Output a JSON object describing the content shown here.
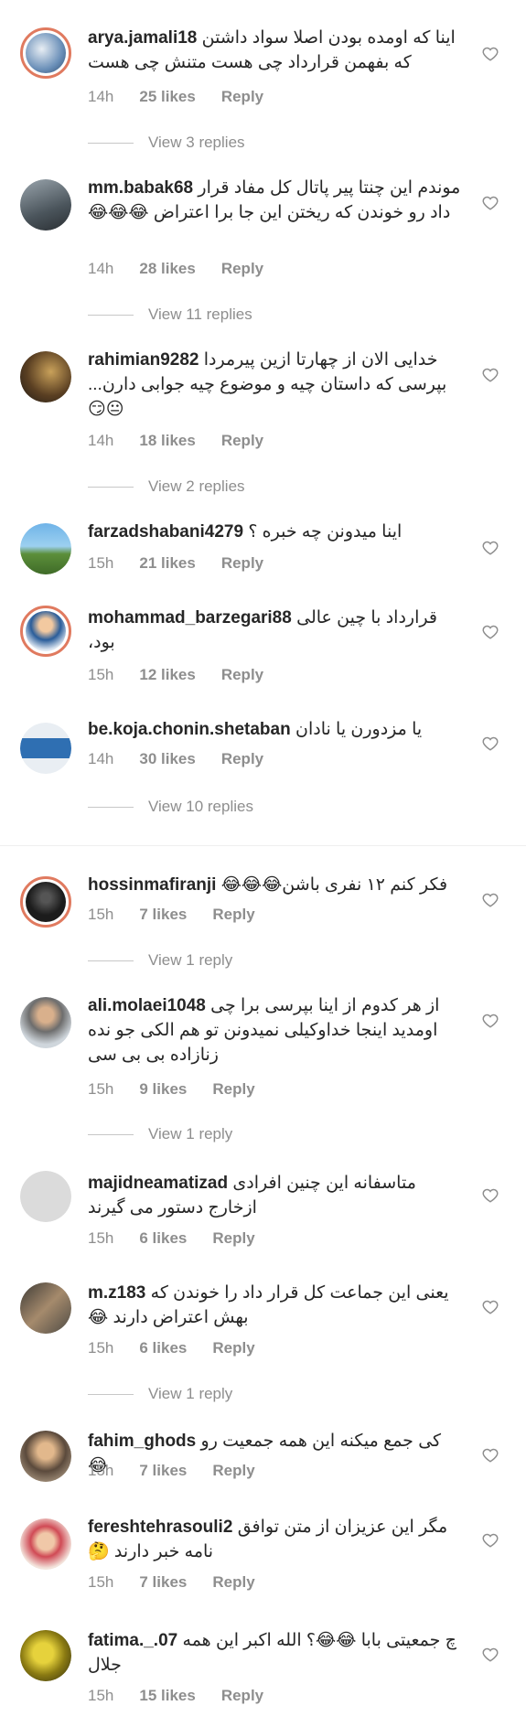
{
  "comments": [
    {
      "username": "arya.jamali18",
      "text": "اینا که اومده بودن اصلا سواد داشتن که بفهمن قرارداد چی هست متنش چی هست",
      "time": "14h",
      "likes": "25 likes",
      "reply": "Reply",
      "view_replies": "View 3 replies"
    },
    {
      "username": "mm.babak68",
      "text": "موندم این چنتا پیر پاتال  کل مفاد قرار داد رو خوندن که ریختن این جا برا اعتراض 😂😂😂",
      "time": "14h",
      "likes": "28 likes",
      "reply": "Reply",
      "view_replies": "View 11 replies"
    },
    {
      "username": "rahimian9282",
      "text": "خدایی الان از چهارتا ازین پیرمردا بپرسی که داستان چیه و موضوع چیه جوابی دارن... 😐😏",
      "time": "14h",
      "likes": "18 likes",
      "reply": "Reply",
      "view_replies": "View 2 replies"
    },
    {
      "username": "farzadshabani4279",
      "text": "اینا میدونن چه خبره ؟",
      "time": "15h",
      "likes": "21 likes",
      "reply": "Reply",
      "view_replies": ""
    },
    {
      "username": "mohammad_barzegari88",
      "text": "قرارداد با چین عالی بود،",
      "time": "15h",
      "likes": "12 likes",
      "reply": "Reply",
      "view_replies": ""
    },
    {
      "username": "be.koja.chonin.shetaban",
      "text": "یا مزدورن یا نادان",
      "time": "14h",
      "likes": "30 likes",
      "reply": "Reply",
      "view_replies": "View 10 replies"
    },
    {
      "username": "hossinmafiranji",
      "text": "فکر کنم ۱۲ نفری باشن😂😂😂",
      "time": "15h",
      "likes": "7 likes",
      "reply": "Reply",
      "view_replies": "View 1 reply"
    },
    {
      "username": "ali.molaei1048",
      "text": "از هر کدوم از اینا بپرسی برا چی اومدید اینجا خداوکیلی نمیدونن تو هم الکی جو نده زنازاده بی بی سی",
      "time": "15h",
      "likes": "9 likes",
      "reply": "Reply",
      "view_replies": "View 1 reply"
    },
    {
      "username": "majidneamatizad",
      "text": "متاسفانه این چنین افرادی ازخارج دستور می گیرند",
      "time": "15h",
      "likes": "6 likes",
      "reply": "Reply",
      "view_replies": ""
    },
    {
      "username": "m.z183",
      "text": "یعنی این جماعت کل قرار داد را خوندن که بهش اعتراض دارند 😂",
      "time": "15h",
      "likes": "6 likes",
      "reply": "Reply",
      "view_replies": "View 1 reply"
    },
    {
      "username": "fahim_ghods",
      "text": "کی جمع میکنه این همه جمعیت رو😂",
      "time": "15h",
      "likes": "7 likes",
      "reply": "Reply",
      "view_replies": ""
    },
    {
      "username": "fereshtehrasouli2",
      "text": "مگر این عزیزان از متن توافق نامه خبر دارند 🤔",
      "time": "15h",
      "likes": "7 likes",
      "reply": "Reply",
      "view_replies": ""
    },
    {
      "username": "fatima._.07",
      "text": "چ جمعیتی بابا 😂😂؟ الله اکبر این همه جلال",
      "time": "15h",
      "likes": "15 likes",
      "reply": "Reply",
      "view_replies": ""
    }
  ],
  "icons": {
    "heart": "heart-outline-icon",
    "avatar": "avatar-photo"
  },
  "colors": {
    "muted": "#8e8e8e",
    "text": "#262626",
    "ring": "#e07a5f"
  }
}
